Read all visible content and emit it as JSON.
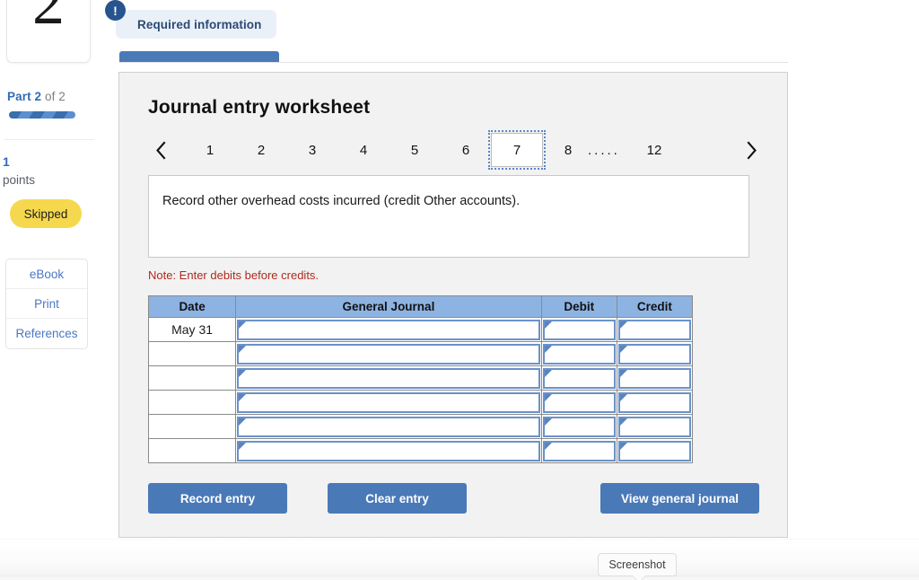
{
  "sidebar": {
    "question_number": "2",
    "part_label_prefix": "Part",
    "part_current": "2",
    "part_of": "of 2",
    "points_value": "1",
    "points_label": "points",
    "status_badge": "Skipped",
    "resources": [
      {
        "label": "eBook"
      },
      {
        "label": "Print"
      },
      {
        "label": "References"
      }
    ]
  },
  "alert": {
    "icon": "exclamation-icon",
    "icon_glyph": "!",
    "label": "Required information"
  },
  "panel": {
    "title": "Journal entry worksheet",
    "prompt": "Record other overhead costs incurred (credit Other accounts).",
    "note": "Note: Enter debits before credits."
  },
  "pager": {
    "prev_icon": "chevron-left-icon",
    "next_icon": "chevron-right-icon",
    "pages": [
      "1",
      "2",
      "3",
      "4",
      "5",
      "6",
      "7",
      "8"
    ],
    "selected": "7",
    "ellipsis": ".....",
    "last_page": "12"
  },
  "journal": {
    "headers": [
      "Date",
      "General Journal",
      "Debit",
      "Credit"
    ],
    "rows": [
      {
        "date": "May 31",
        "general_journal": "",
        "debit": "",
        "credit": ""
      },
      {
        "date": "",
        "general_journal": "",
        "debit": "",
        "credit": ""
      },
      {
        "date": "",
        "general_journal": "",
        "debit": "",
        "credit": ""
      },
      {
        "date": "",
        "general_journal": "",
        "debit": "",
        "credit": ""
      },
      {
        "date": "",
        "general_journal": "",
        "debit": "",
        "credit": ""
      },
      {
        "date": "",
        "general_journal": "",
        "debit": "",
        "credit": ""
      }
    ]
  },
  "buttons": {
    "record": "Record entry",
    "clear": "Clear entry",
    "view": "View general journal"
  },
  "tooltip": {
    "label": "Screenshot"
  },
  "colors": {
    "accent_blue": "#4a79b8",
    "link_blue": "#4b77c4",
    "table_header_blue": "#8db3e2",
    "input_border_blue": "#6b92c9",
    "note_red": "#b02a1f",
    "skipped_yellow": "#f6d84e",
    "badge_bg": "#eaf0f8",
    "badge_text": "#2c4a73"
  }
}
